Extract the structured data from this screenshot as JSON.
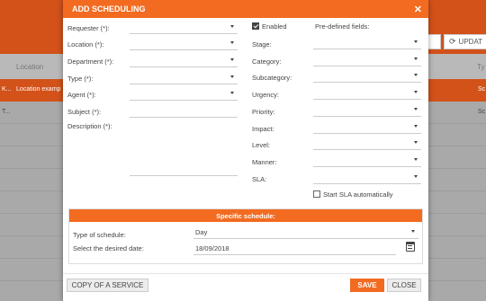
{
  "background": {
    "btn_partial_label": "TE",
    "btn_update_label": "UPDAT",
    "col_location": "Location",
    "col_type": "Ty",
    "row1": {
      "c1": "K...",
      "c2": "Location examp",
      "c3": "Sc"
    },
    "row2": {
      "c1": "T...",
      "c3": "Sc"
    }
  },
  "modal": {
    "title": "ADD SCHEDULING",
    "left_fields": [
      {
        "label": "Requester (*):",
        "value": ""
      },
      {
        "label": "Location (*):",
        "value": ""
      },
      {
        "label": "Department (*):",
        "value": ""
      },
      {
        "label": "Type (*):",
        "value": ""
      },
      {
        "label": "Agent (*):",
        "value": ""
      }
    ],
    "subject_label": "Subject (*):",
    "description_label": "Description (*):",
    "enabled_label": "Enabled",
    "enabled_checked": true,
    "predefined_label": "Pre-defined fields:",
    "right_fields": [
      {
        "label": "Stage:"
      },
      {
        "label": "Category:"
      },
      {
        "label": "Subcategory:"
      },
      {
        "label": "Urgency:"
      },
      {
        "label": "Priority:"
      },
      {
        "label": "Impact:"
      },
      {
        "label": "Level:"
      },
      {
        "label": "Manner:"
      },
      {
        "label": "SLA:"
      }
    ],
    "start_sla_label": "Start SLA automatically",
    "start_sla_checked": false,
    "specific": {
      "title": "Specific schedule:",
      "type_label": "Type of schedule:",
      "type_value": "Day",
      "date_label": "Select the desired date:",
      "date_value": "18/09/2018"
    },
    "buttons": {
      "copy": "COPY OF A SERVICE",
      "save": "SAVE",
      "close": "CLOSE"
    }
  },
  "colors": {
    "accent": "#f26b21",
    "header_bg": "#d2521a"
  }
}
